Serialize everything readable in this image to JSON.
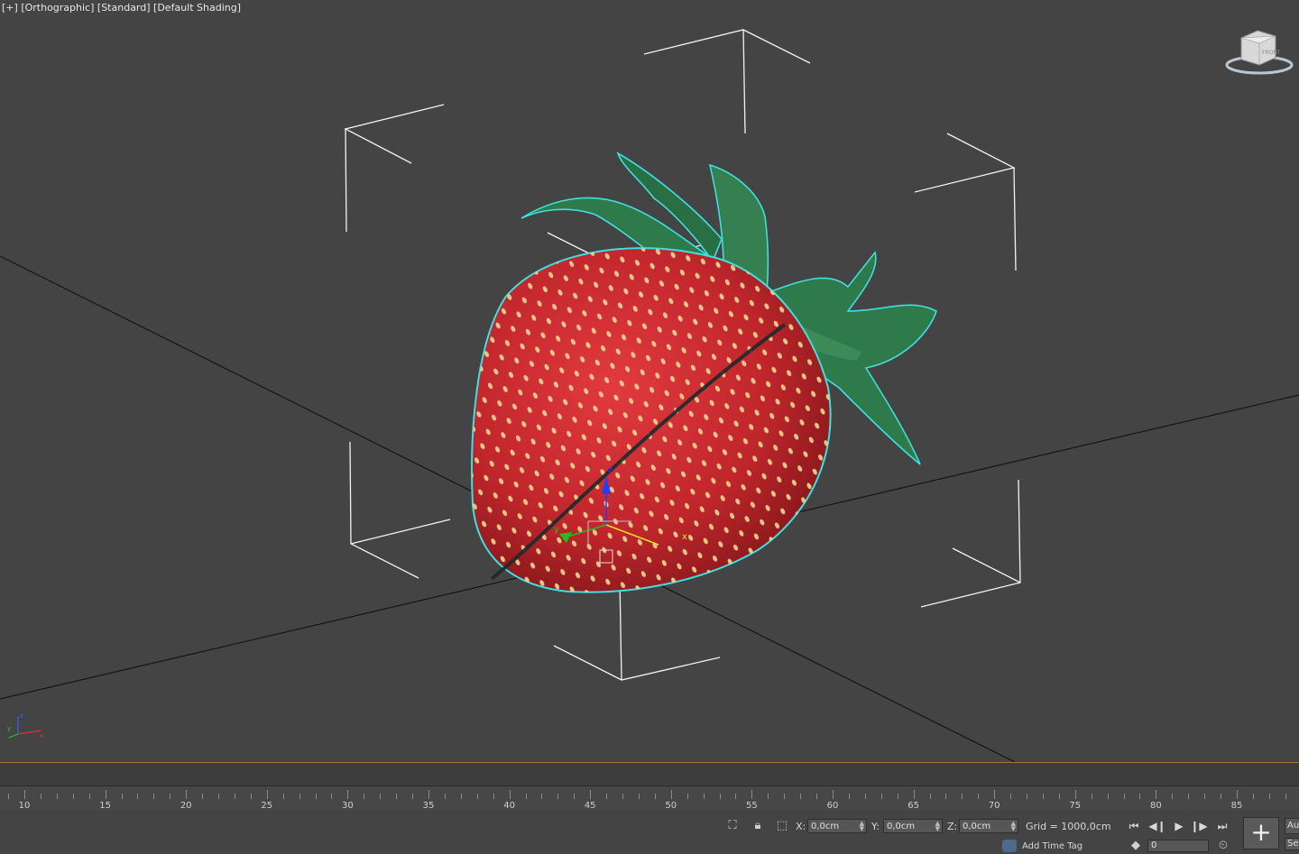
{
  "viewport": {
    "label_parts": [
      "[+]",
      "[Orthographic]",
      "[Standard]",
      "[Default Shading]"
    ],
    "gizmo_labels": {
      "x": "x",
      "y": "y",
      "z": "z"
    }
  },
  "viewcube": {
    "label": "FRONT"
  },
  "timeline": {
    "ticks": [
      "10",
      "15",
      "20",
      "25",
      "30",
      "35",
      "40",
      "45",
      "50",
      "55",
      "60",
      "65",
      "70",
      "75",
      "80",
      "85"
    ]
  },
  "status": {
    "x_label": "X:",
    "x_value": "0,0cm",
    "y_label": "Y:",
    "y_value": "0,0cm",
    "z_label": "Z:",
    "z_value": "0,0cm",
    "grid": "Grid = 1000,0cm",
    "add_time_tag": "Add Time Tag",
    "frame_value": "0",
    "auto_label": "Auto",
    "set_label": "Set"
  },
  "colors": {
    "viewport_bg": "#444444",
    "selection_outline": "#3de0e0",
    "strawberry": "#c0262c",
    "leaves": "#2f7a4a",
    "timeline_accent": "#9a7f3a"
  }
}
